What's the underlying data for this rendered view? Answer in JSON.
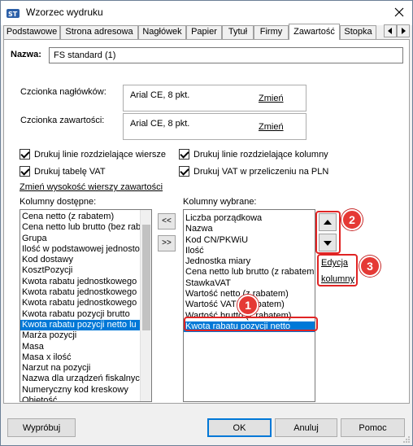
{
  "window": {
    "title": "Wzorzec wydruku"
  },
  "tabs": [
    "Podstawowe",
    "Strona adresowa",
    "Nagłówek",
    "Papier",
    "Tytuł",
    "Firmy",
    "Zawartość",
    "Stopka"
  ],
  "name": {
    "label": "Nazwa:",
    "value": "FS standard (1)"
  },
  "fonts": {
    "header_label": "Czcionka nagłówków:",
    "header_value": "Arial CE, 8 pkt.",
    "content_label": "Czcionka zawartości:",
    "content_value": "Arial CE, 8 pkt.",
    "change_label": "Zmień"
  },
  "checkboxes": {
    "row_lines": "Drukuj linie rozdzielające wiersze",
    "column_lines": "Drukuj linie rozdzielające kolumny",
    "vat_table": "Drukuj tabelę VAT",
    "vat_pln": "Drukuj VAT w przeliczeniu na PLN"
  },
  "row_height_link": "Zmień wysokość wierszy zawartości",
  "available": {
    "label": "Kolumny dostępne:",
    "items": [
      "Cena netto (z rabatem)",
      "Cena netto lub brutto (bez rab",
      "Grupa",
      "Ilość w podstawowej jednosto",
      "Kod dostawy",
      "KosztPozycji",
      "Kwota rabatu jednostkowego",
      "Kwota rabatu jednostkowego",
      "Kwota rabatu jednostkowego",
      "Kwota rabatu pozycji brutto",
      "Kwota rabatu pozycji netto lu",
      "Marża pozycji",
      "Masa",
      "Masa x ilość",
      "Narzut na pozycji",
      "Nazwa dla urządzeń fiskalnych",
      "Numeryczny kod kreskowy",
      "Objętość"
    ],
    "selected_index": 10
  },
  "move": {
    "remove": "<<",
    "add": ">>"
  },
  "selected": {
    "label": "Kolumny wybrane:",
    "items": [
      "Liczba porządkowa",
      "Nazwa",
      "Kod CN/PKWiU",
      "Ilość",
      "Jednostka miary",
      "Cena netto lub brutto (z rabatem",
      "StawkaVAT",
      "Wartość netto (z rabatem)",
      "Wartość VAT (z rabatem)",
      "Wartość brutto (z rabatem)",
      "Kwota rabatu pozycji netto"
    ],
    "selected_index": 10
  },
  "edit_column": {
    "line1": "Edycja",
    "line2": "kolumny"
  },
  "badges": [
    "1",
    "2",
    "3"
  ],
  "footer": {
    "preview": "Wypróbuj",
    "ok": "OK",
    "cancel": "Anuluj",
    "help": "Pomoc"
  },
  "colors": {
    "selection": "#0078d7",
    "annotation": "#e53935"
  }
}
